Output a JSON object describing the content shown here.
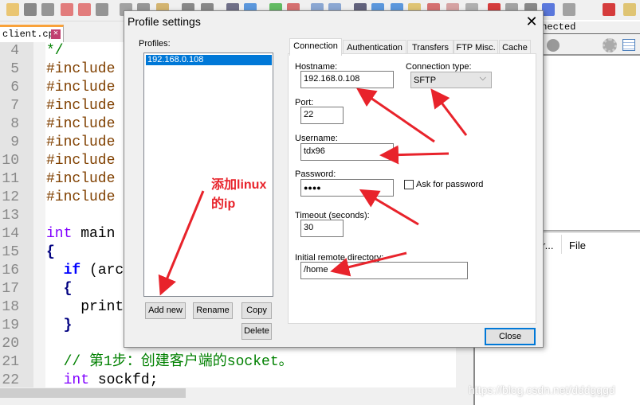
{
  "editor": {
    "file_tab": "client.cpp",
    "lines": [
      {
        "n": "4",
        "text": "*/",
        "cls": "cm"
      },
      {
        "n": "5",
        "text": "#include",
        "cls": "pp"
      },
      {
        "n": "6",
        "text": "#include",
        "cls": "pp"
      },
      {
        "n": "7",
        "text": "#include",
        "cls": "pp"
      },
      {
        "n": "8",
        "text": "#include",
        "cls": "pp"
      },
      {
        "n": "9",
        "text": "#include",
        "cls": "pp"
      },
      {
        "n": "10",
        "text": "#include",
        "cls": "pp"
      },
      {
        "n": "11",
        "text": "#include",
        "cls": "pp"
      },
      {
        "n": "12",
        "text": "#include",
        "cls": "pp"
      },
      {
        "n": "13",
        "text": "",
        "cls": ""
      },
      {
        "n": "14",
        "text": "int main",
        "cls": "mix1"
      },
      {
        "n": "15",
        "text": "{",
        "cls": "br"
      },
      {
        "n": "16",
        "text": "  if (arc",
        "cls": "mix2"
      },
      {
        "n": "17",
        "text": "  {",
        "cls": "br"
      },
      {
        "n": "18",
        "text": "    print",
        "cls": ""
      },
      {
        "n": "19",
        "text": "  }",
        "cls": "br"
      },
      {
        "n": "20",
        "text": "",
        "cls": ""
      },
      {
        "n": "21",
        "text": "  // 第1步：创建客户端的socket。",
        "cls": "cm"
      },
      {
        "n": "22",
        "text": "  int sockfd;",
        "cls": "mix3"
      }
    ]
  },
  "right_panel": {
    "status": "nnected",
    "col_header_1": "r...",
    "col_header_2": "File"
  },
  "watermark": "https://blog.csdn.net/dddgggd",
  "dialog": {
    "title": "Profile settings",
    "profiles_label": "Profiles:",
    "profiles": [
      "192.168.0.108"
    ],
    "buttons": {
      "add_new": "Add new",
      "rename": "Rename",
      "copy": "Copy",
      "delete": "Delete",
      "close": "Close"
    },
    "tabs": [
      "Connection",
      "Authentication",
      "Transfers",
      "FTP Misc.",
      "Cache"
    ],
    "active_tab": "Connection",
    "fields": {
      "hostname_label": "Hostname:",
      "hostname": "192.168.0.108",
      "connection_type_label": "Connection type:",
      "connection_type": "SFTP",
      "port_label": "Port:",
      "port": "22",
      "username_label": "Username:",
      "username": "tdx96",
      "password_label": "Password:",
      "password": "●●●●",
      "ask_password_label": "Ask for password",
      "ask_password": false,
      "timeout_label": "Timeout (seconds):",
      "timeout": "30",
      "remote_dir_label": "Initial remote directory:",
      "remote_dir": "/home"
    }
  },
  "annotation": {
    "text_line1": "添加linux",
    "text_line2": "的ip",
    "color": "#e8232b"
  }
}
